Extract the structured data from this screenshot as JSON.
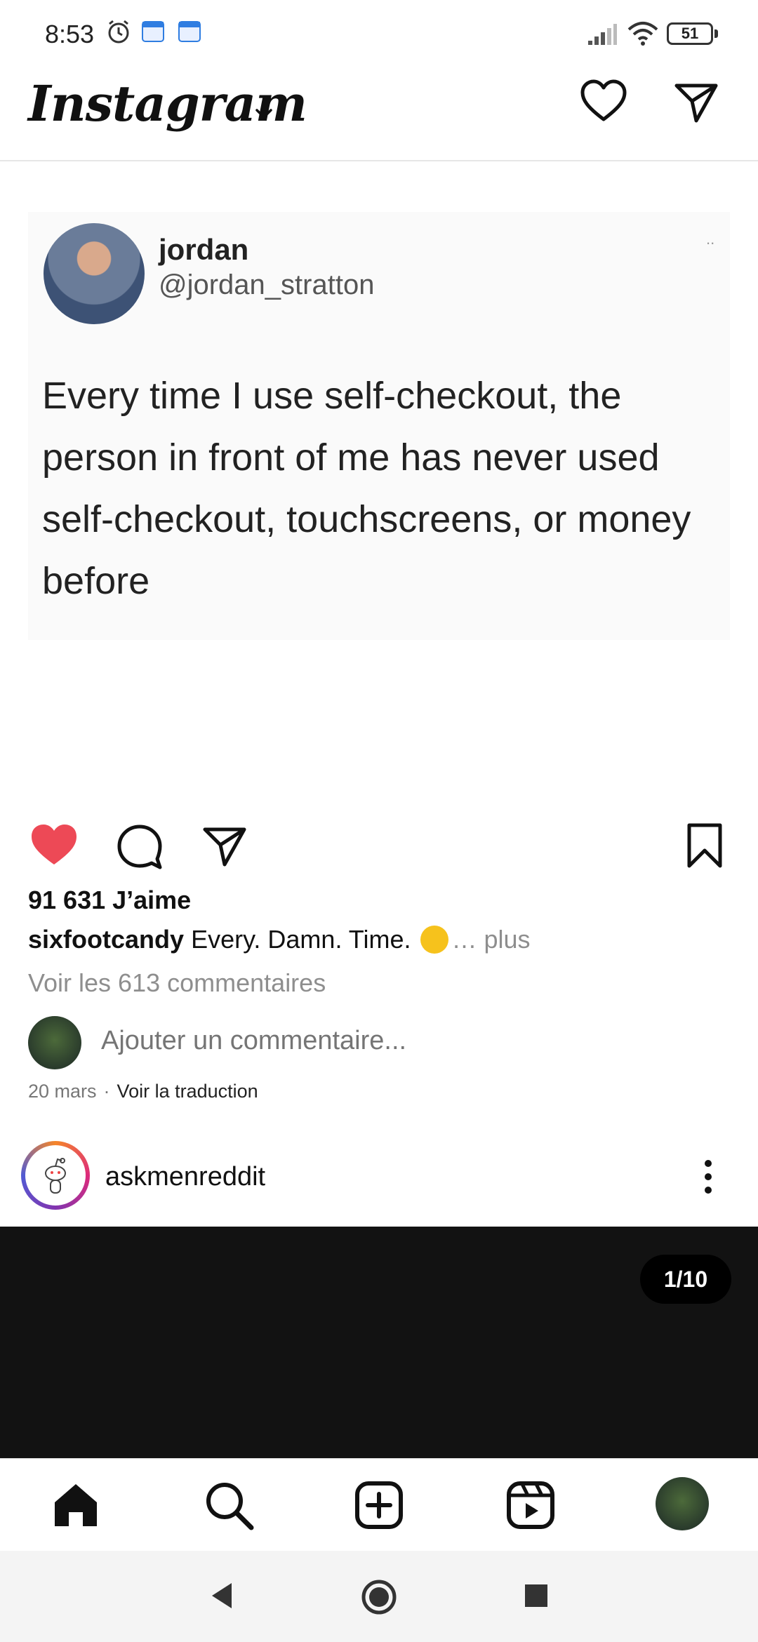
{
  "status_bar": {
    "time": "8:53",
    "battery": "51",
    "icons": [
      "alarm-icon",
      "calendar-icon",
      "calendar-icon",
      "signal-icon",
      "wifi-icon",
      "battery-icon"
    ]
  },
  "header": {
    "logo": "Instagram",
    "icons": [
      "chevron-down-icon",
      "heart-icon",
      "send-icon"
    ]
  },
  "post": {
    "tweet": {
      "name": "jordan",
      "handle": "@jordan_stratton",
      "more": "..",
      "text": "Every time I use self-checkout, the person in front of me has never used self-checkout, touchscreens, or money before"
    },
    "likes": "91 631 J’aime",
    "caption_user": "sixfootcandy",
    "caption_text": "Every. Damn. Time.",
    "caption_more": "… plus",
    "view_comments": "Voir les 613 commentaires",
    "comment_placeholder": "Ajouter un commentaire...",
    "date": "20 mars",
    "date_sep": "·",
    "translate": "Voir la traduction",
    "liked_color": "#ed4956"
  },
  "next_post": {
    "username": "askmenreddit",
    "page_counter": "1/10"
  },
  "bottom_nav": {
    "items": [
      "home-icon",
      "search-icon",
      "create-icon",
      "reels-icon",
      "profile-avatar"
    ]
  }
}
